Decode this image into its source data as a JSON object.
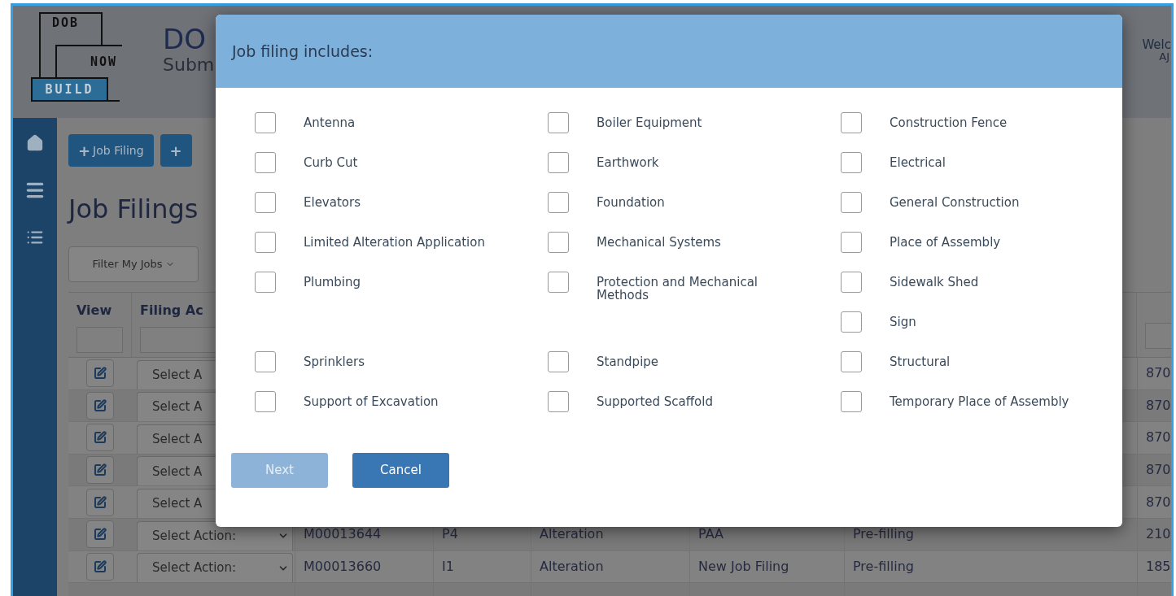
{
  "header": {
    "logo": {
      "line_1": "DOB",
      "line_2": "NOW",
      "line_3": "BUILD"
    },
    "title": "DO",
    "subtitle": "Subm",
    "welcome": "Welc",
    "user": "AJ"
  },
  "sidebar": {
    "items": [
      {
        "kind": "home"
      },
      {
        "kind": "menu"
      },
      {
        "kind": "list"
      }
    ]
  },
  "toolbar": {
    "buttons": [
      {
        "label": "Job Filing",
        "icon": "+"
      },
      {
        "icon": "+"
      }
    ]
  },
  "page_title": "Job Filings",
  "filter_button": "Filter My Jobs",
  "table": {
    "columns": [
      "View",
      "Filing Ac"
    ],
    "rows": [
      {
        "action": "Select A",
        "column_8": "870"
      },
      {
        "action": "Select A",
        "column_8": "870"
      },
      {
        "action": "Select A",
        "column_8": "870"
      },
      {
        "action": "Select A",
        "column_8": "870"
      },
      {
        "action": "Select A",
        "column_8": "870"
      },
      {
        "action": "Select Action:",
        "column_3": "M00013644",
        "column_4": "P4",
        "column_5": "Alteration",
        "column_6": "PAA",
        "column_7": "Pre-filling",
        "column_8": "210"
      },
      {
        "action": "Select Action:",
        "column_3": "M00013660",
        "column_4": "I1",
        "column_5": "Alteration",
        "column_6": "New Job Filing",
        "column_7": "Pre-filling",
        "column_8": "185"
      },
      {}
    ]
  },
  "dialog": {
    "title": "Job filing includes:",
    "rows": [
      {
        "column_1": {
          "label": "Antenna",
          "checked": false
        },
        "column_2": {
          "label": "Boiler Equipment",
          "checked": false
        },
        "column_3": {
          "label": "Construction Fence",
          "checked": false
        }
      },
      {
        "column_1": {
          "label": "Curb Cut",
          "checked": false
        },
        "column_2": {
          "label": "Earthwork",
          "checked": false
        },
        "column_3": {
          "label": "Electrical",
          "checked": false
        }
      },
      {
        "column_1": {
          "label": "Elevators",
          "checked": false
        },
        "column_2": {
          "label": "Foundation",
          "checked": false
        },
        "column_3": {
          "label": "General Construction",
          "checked": false
        }
      },
      {
        "column_1": {
          "label": "Limited Alteration Application",
          "checked": false
        },
        "column_2": {
          "label": "Mechanical Systems",
          "checked": false
        },
        "column_3": {
          "label": "Place of Assembly",
          "checked": false
        }
      },
      {
        "column_1": {
          "label": "Plumbing",
          "checked": false
        },
        "column_2": {
          "label": "Protection and Mechanical Methods",
          "checked": false
        },
        "column_3": {
          "label": "Sidewalk Shed",
          "checked": false
        }
      },
      {
        "column_3": {
          "label": "Sign",
          "checked": false
        }
      },
      {
        "column_1": {
          "label": "Sprinklers",
          "checked": false
        },
        "column_2": {
          "label": "Standpipe",
          "checked": false
        },
        "column_3": {
          "label": "Structural",
          "checked": false
        }
      },
      {
        "column_1": {
          "label": "Support of Excavation",
          "checked": false
        },
        "column_2": {
          "label": "Supported Scaffold",
          "checked": false
        },
        "column_3": {
          "label": "Temporary Place of Assembly",
          "checked": false
        }
      }
    ],
    "buttons": [
      {
        "label": "Next",
        "disabled": true
      },
      {
        "label": "Cancel",
        "disabled": false
      }
    ]
  }
}
